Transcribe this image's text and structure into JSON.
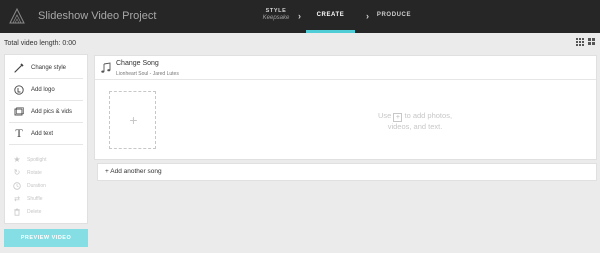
{
  "header": {
    "app_title": "Slideshow Video Project",
    "steps": [
      {
        "label": "STYLE",
        "sub": "Keepsake"
      },
      {
        "label": "CREATE"
      },
      {
        "label": "PRODUCE"
      }
    ],
    "accent_color": "#4fcdd6"
  },
  "subbar": {
    "video_length": "Total video length: 0:00",
    "view_icons": [
      "small-grid-view-icon",
      "large-grid-view-icon"
    ]
  },
  "sidebar": {
    "items": [
      {
        "label": "Change style",
        "icon": "brush-icon"
      },
      {
        "label": "Add logo",
        "icon": "logo-circle-icon"
      },
      {
        "label": "Add pics & vids",
        "icon": "photos-icon"
      },
      {
        "label": "Add text",
        "icon": "text-t-icon"
      }
    ],
    "disabled_items": [
      {
        "label": "Spotlight",
        "icon": "star-icon"
      },
      {
        "label": "Rotate",
        "icon": "rotate-icon"
      },
      {
        "label": "Duration",
        "icon": "clock-icon"
      },
      {
        "label": "Shuffle",
        "icon": "shuffle-icon"
      },
      {
        "label": "Delete",
        "icon": "trash-icon"
      }
    ],
    "preview_label": "PREVIEW VIDEO"
  },
  "song": {
    "title": "Change Song",
    "artist": "Lionheart Soul - Jared Lutes",
    "hint_pre": "Use",
    "hint_box": "+",
    "hint_post": "to add photos,",
    "hint_line2": "videos, and text.",
    "slot_plus": "+"
  },
  "add_song": {
    "label": "+ Add another song"
  }
}
